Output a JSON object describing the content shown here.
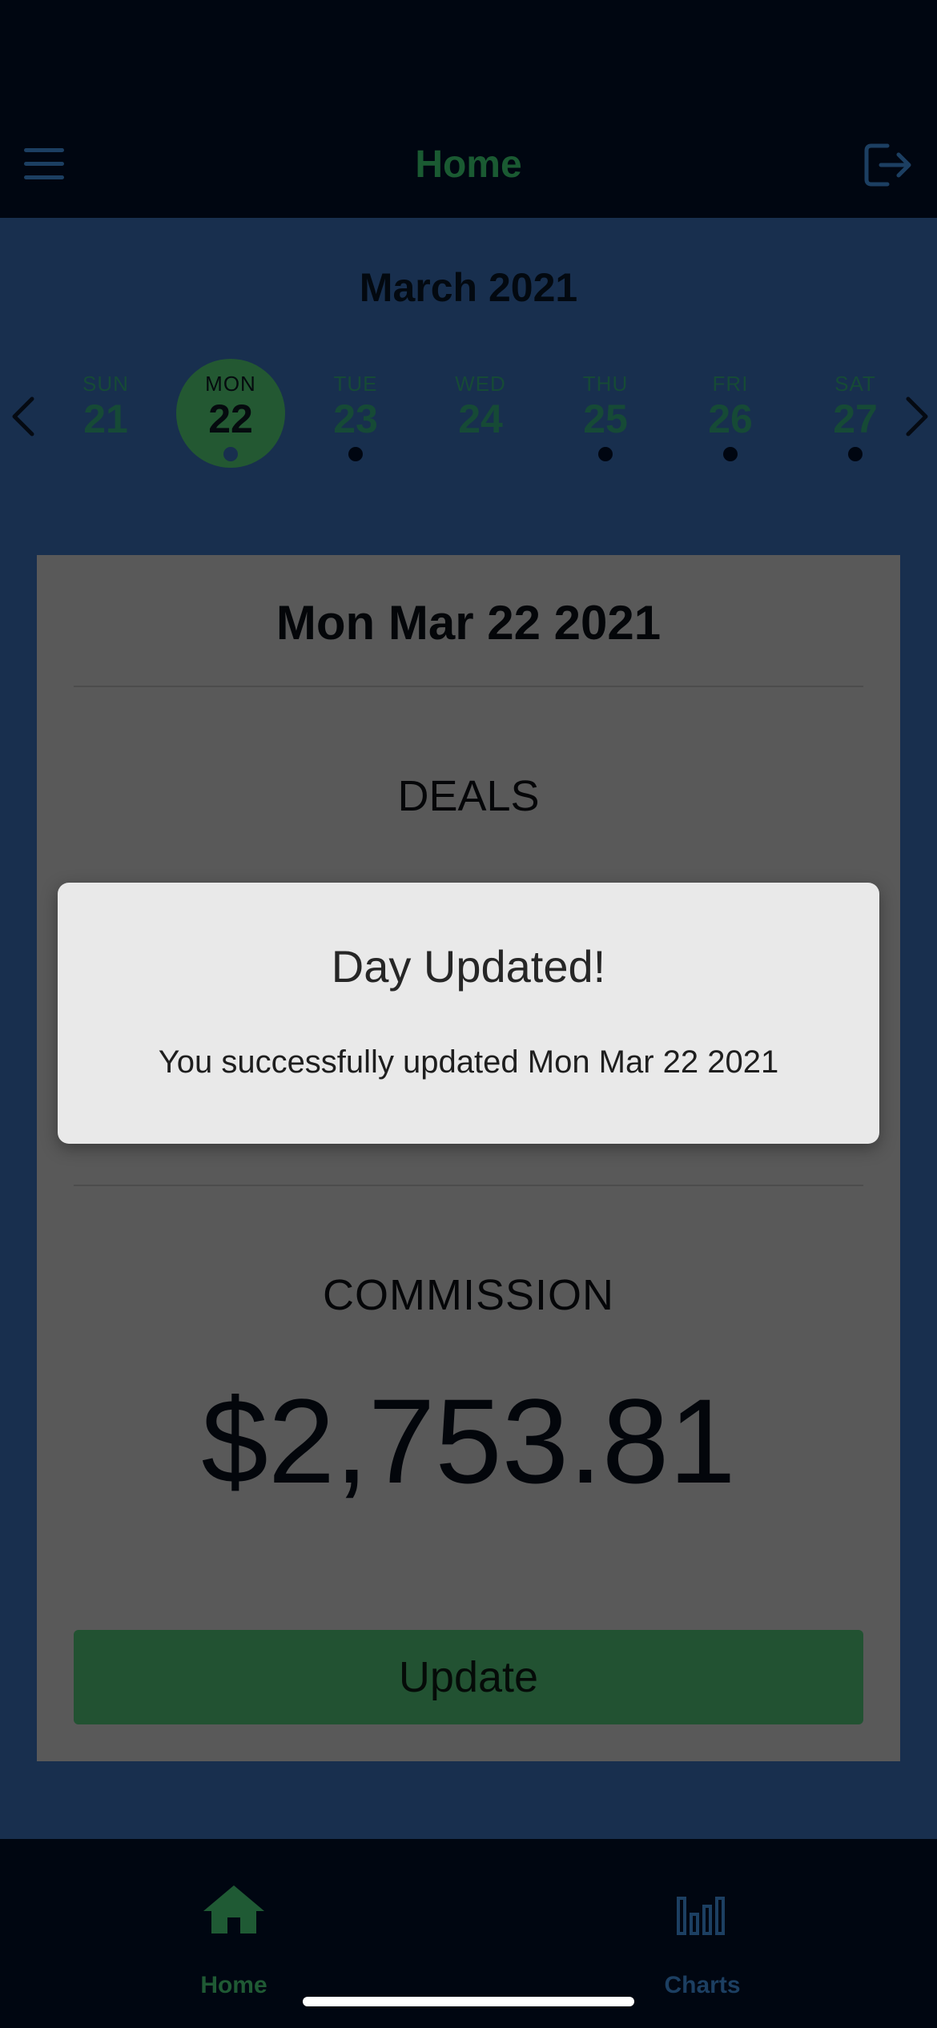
{
  "header": {
    "title": "Home",
    "menu_icon": "hamburger-menu-icon",
    "logout_icon": "logout-icon"
  },
  "calendar": {
    "month_label": "March 2021",
    "days": [
      {
        "dow": "SUN",
        "num": "21",
        "selected": false,
        "has_entry": false
      },
      {
        "dow": "MON",
        "num": "22",
        "selected": true,
        "has_entry": true
      },
      {
        "dow": "TUE",
        "num": "23",
        "selected": false,
        "has_entry": true
      },
      {
        "dow": "WED",
        "num": "24",
        "selected": false,
        "has_entry": false
      },
      {
        "dow": "THU",
        "num": "25",
        "selected": false,
        "has_entry": true
      },
      {
        "dow": "FRI",
        "num": "26",
        "selected": false,
        "has_entry": true
      },
      {
        "dow": "SAT",
        "num": "27",
        "selected": false,
        "has_entry": true
      }
    ]
  },
  "card": {
    "date_title": "Mon Mar 22 2021",
    "deals_label": "DEALS",
    "commission_label": "COMMISSION",
    "commission_value": "$2,753.81",
    "update_label": "Update"
  },
  "modal": {
    "title": "Day Updated!",
    "message": "You successfully updated Mon Mar 22 2021"
  },
  "tabbar": {
    "tabs": [
      {
        "label": "Home",
        "icon": "home-icon",
        "active": true
      },
      {
        "label": "Charts",
        "icon": "bar-chart-icon",
        "active": false
      }
    ]
  },
  "colors": {
    "background": "#000611",
    "main_background": "#182f4e",
    "accent_green": "#235832",
    "card_background": "#595959",
    "inactive_tab": "#1c3f62"
  }
}
